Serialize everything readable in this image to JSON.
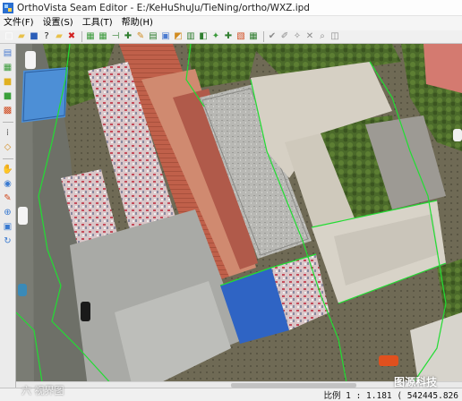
{
  "window": {
    "title": "OrthoVista Seam Editor - E:/KeHuShuJu/TieNing/ortho/WXZ.ipd"
  },
  "menu": {
    "items": [
      "文件(F)",
      "设置(S)",
      "工具(T)",
      "帮助(H)"
    ]
  },
  "toolbar": {
    "buttons": [
      {
        "name": "new-icon",
        "glyph": "□",
        "color": "#ffffff"
      },
      {
        "name": "open-folder-icon",
        "glyph": "▰",
        "color": "#e8c14a"
      },
      {
        "name": "save-icon",
        "glyph": "■",
        "color": "#2a5db8"
      },
      {
        "name": "help-pointer-icon",
        "glyph": "?",
        "color": "#1b1b1b"
      },
      {
        "name": "folder-icon",
        "glyph": "▰",
        "color": "#e8c14a"
      },
      {
        "name": "delete-icon",
        "glyph": "✖",
        "color": "#d32020"
      },
      {
        "name": "seam-tool-1-icon",
        "glyph": "▦",
        "color": "#3a9a3a"
      },
      {
        "name": "seam-tool-2-icon",
        "glyph": "▦",
        "color": "#3a9a3a"
      },
      {
        "name": "seam-tool-3-icon",
        "glyph": "⊣",
        "color": "#2e7d2e"
      },
      {
        "name": "seam-tool-4-icon",
        "glyph": "✚",
        "color": "#2e7d2e"
      },
      {
        "name": "seam-tool-5-icon",
        "glyph": "✎",
        "color": "#d18b1f"
      },
      {
        "name": "seam-tool-6-icon",
        "glyph": "▤",
        "color": "#2e7d2e"
      },
      {
        "name": "seam-tool-7-icon",
        "glyph": "▣",
        "color": "#4a7bd0"
      },
      {
        "name": "seam-tool-8-icon",
        "glyph": "◩",
        "color": "#d18b1f"
      },
      {
        "name": "seam-tool-9-icon",
        "glyph": "▥",
        "color": "#2e7d2e"
      },
      {
        "name": "seam-tool-10-icon",
        "glyph": "◧",
        "color": "#2e7d2e"
      },
      {
        "name": "seam-tool-11-icon",
        "glyph": "✦",
        "color": "#3a9a3a"
      },
      {
        "name": "seam-tool-12-icon",
        "glyph": "✚",
        "color": "#2e7d2e"
      },
      {
        "name": "seam-tool-13-icon",
        "glyph": "▧",
        "color": "#d14a1f"
      },
      {
        "name": "seam-tool-14-icon",
        "glyph": "▦",
        "color": "#2e7d2e"
      },
      {
        "name": "check-icon",
        "glyph": "✔",
        "color": "#8a8a8a"
      },
      {
        "name": "pencil-icon",
        "glyph": "✐",
        "color": "#8a8a8a"
      },
      {
        "name": "wand-icon",
        "glyph": "✧",
        "color": "#8a8a8a"
      },
      {
        "name": "wrench-icon",
        "glyph": "✕",
        "color": "#8a8a8a"
      },
      {
        "name": "zoom-tool-icon",
        "glyph": "⌕",
        "color": "#8a8a8a"
      },
      {
        "name": "pan-tool-icon",
        "glyph": "◫",
        "color": "#8a8a8a"
      }
    ]
  },
  "vtoolbar": {
    "buttons": [
      {
        "name": "layer-icon",
        "glyph": "▤",
        "color": "#4a7bd0"
      },
      {
        "name": "grid-icon",
        "glyph": "▦",
        "color": "#3a9a3a"
      },
      {
        "name": "color-box-icon",
        "glyph": "■",
        "color": "#e0b020"
      },
      {
        "name": "color-box-2-icon",
        "glyph": "■",
        "color": "#3aa03a"
      },
      {
        "name": "swatch-icon",
        "glyph": "▩",
        "color": "#d04a1f"
      },
      {
        "name": "dotted-grid-icon",
        "glyph": "⁞",
        "color": "#555555"
      },
      {
        "name": "polygon-icon",
        "glyph": "◇",
        "color": "#d18b1f"
      },
      {
        "name": "hand-icon",
        "glyph": "✋",
        "color": "#444444"
      },
      {
        "name": "target-icon",
        "glyph": "◉",
        "color": "#3a7ad0"
      },
      {
        "name": "paint-icon",
        "glyph": "✎",
        "color": "#d04a1f"
      },
      {
        "name": "zoom-in-icon",
        "glyph": "⊕",
        "color": "#3a7ad0"
      },
      {
        "name": "info-icon",
        "glyph": "▣",
        "color": "#3a7ad0"
      },
      {
        "name": "refresh-icon",
        "glyph": "↻",
        "color": "#3a7ad0"
      }
    ]
  },
  "status": {
    "scale_text": "比例 1 : 1.181  ( 542445.826"
  },
  "overlay": {
    "left_mark": "六 视界图",
    "right_mark": "图源科技"
  },
  "colors": {
    "seam_line": "#22dd33",
    "window_bg": "#f0f0f0"
  }
}
